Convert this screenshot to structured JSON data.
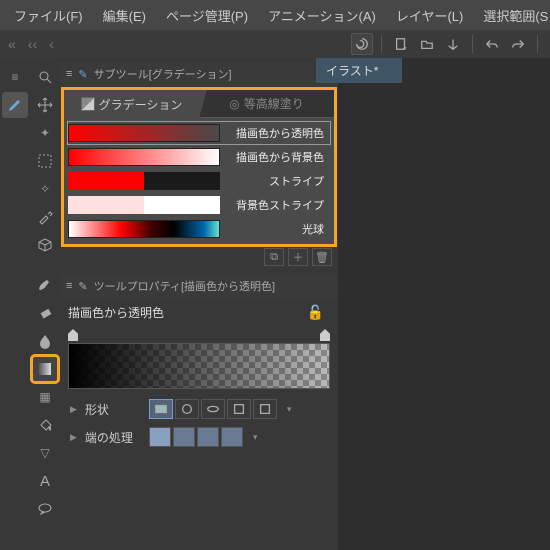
{
  "menu": {
    "file": "ファイル(F)",
    "edit": "編集(E)",
    "page": "ページ管理(P)",
    "anim": "アニメーション(A)",
    "layer": "レイヤー(L)",
    "select": "選択範囲(S"
  },
  "doc_tab": "イラスト*",
  "subtool_header": "サブツール[グラデーション]",
  "sub_tabs": {
    "gradient": "グラデーション",
    "contour": "等高線塗り"
  },
  "grad_items": [
    {
      "label": "描画色から透明色"
    },
    {
      "label": "描画色から背景色"
    },
    {
      "label": "ストライプ"
    },
    {
      "label": "背景色ストライプ"
    },
    {
      "label": "光球"
    }
  ],
  "prop_header": "ツールプロパティ[描画色から透明色]",
  "prop_title": "描画色から透明色",
  "prop_rows": {
    "shape": "形状",
    "edge": "端の処理"
  }
}
